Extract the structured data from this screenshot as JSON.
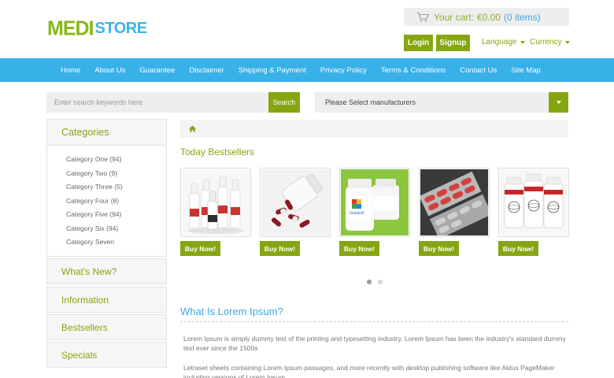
{
  "logo": {
    "part1": "MEDI",
    "part2": "STORE"
  },
  "cart": {
    "icon": "cart-icon",
    "label": "Your cart:",
    "amount": "€0.00",
    "items": "(0 items)"
  },
  "auth": {
    "login": "Login",
    "signup": "Signup"
  },
  "header_links": {
    "language": "Language",
    "currency": "Currency"
  },
  "nav": {
    "items": [
      "Home",
      "About Us",
      "Guarantee",
      "Disclaimer",
      "Shipping & Payment",
      "Privacy Policy",
      "Terms & Conditions",
      "Contact Us",
      "Site Map"
    ]
  },
  "search": {
    "placeholder": "Enter search keywords here",
    "button": "Search"
  },
  "manufacturer": {
    "selected": "Please Select manufacturers"
  },
  "sidebar": {
    "categories_title": "Categories",
    "categories": [
      "Category One (94)",
      "Category Two (9)",
      "Category Three (5)",
      "Category Four (6)",
      "Category Five (94)",
      "Category Six (94)",
      "Category Seven"
    ],
    "boxes": [
      "What's New?",
      "Information",
      "Bestsellers",
      "Specials"
    ]
  },
  "breadcrumb": {
    "icon": "home-icon"
  },
  "bestsellers": {
    "title": "Today Bestsellers",
    "buy_label": "Buy Now!",
    "products": [
      {
        "image": "dropper-bottles-image"
      },
      {
        "image": "capsules-spill-image"
      },
      {
        "image": "supplement-bottle-image",
        "brand": "Gravicol"
      },
      {
        "image": "blister-pack-image"
      },
      {
        "image": "labeled-bottles-image"
      }
    ],
    "pager": {
      "pages": 2,
      "active": 1
    }
  },
  "about": {
    "title": "What Is Lorem Ipsum?",
    "paragraphs": [
      "Lorem Ipsum is simply dummy text of the printing and typesetting industry. Lorem Ipsum has been the industry's standard dummy text ever since the 1500s",
      "Letraset sheets containing Lorem Ipsum passages, and more recently with desktop publishing software like Aldus PageMaker including versions of Lorem Ipsum."
    ]
  },
  "colors": {
    "green": "#86a611",
    "blue": "#37b1e8"
  }
}
